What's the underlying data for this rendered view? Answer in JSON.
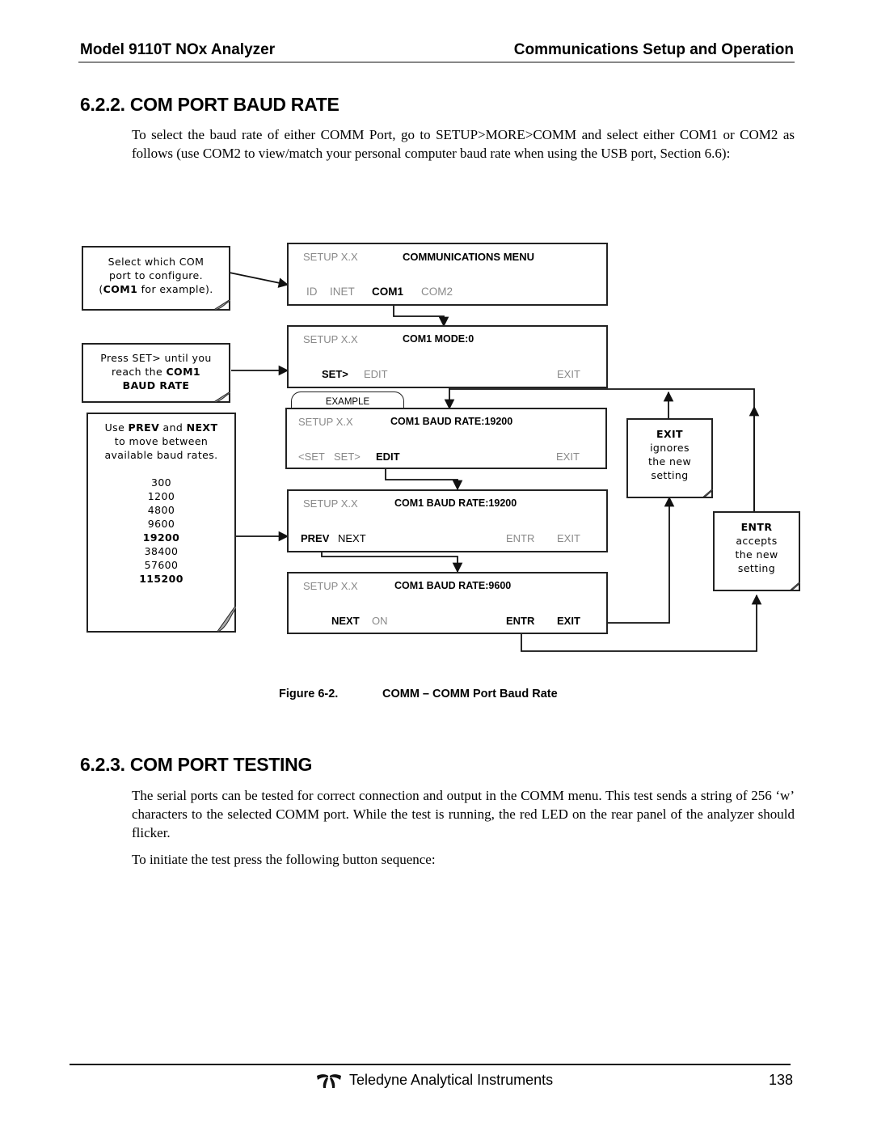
{
  "header": {
    "left": "Model 9110T NOx Analyzer",
    "right": "Communications Setup and Operation"
  },
  "section_baud": {
    "title": "6.2.2. COM PORT BAUD RATE",
    "paragraph": "To select the baud rate of either COMM Port, go to SETUP>MORE>COMM and select either COM1 or COM2 as follows (use COM2 to view/match your personal computer baud rate when using the USB port, Section 6.6):"
  },
  "figure": {
    "notes": {
      "select_com": {
        "line1": "Select which COM",
        "line2": "port to configure.",
        "line3_pre": "(",
        "line3_bold": "COM1",
        "line3_post": " for example)."
      },
      "press_set": {
        "line1": "Press SET> until you",
        "line2_pre": "reach the ",
        "line2_bold": "COM1",
        "line3_bold": "BAUD RATE"
      },
      "prev_next": {
        "pre": "Use ",
        "b1": "PREV",
        "mid": " and ",
        "b2": "NEXT",
        "line2": "to move between",
        "line3": "available baud rates."
      },
      "exit": {
        "title": "EXIT",
        "line1": "ignores",
        "line2": "the new",
        "line3": "setting"
      },
      "entr": {
        "title": "ENTR",
        "line1": "accepts",
        "line2": "the new",
        "line3": "setting"
      }
    },
    "baud_rates": [
      "300",
      "1200",
      "4800",
      "9600",
      "19200",
      "38400",
      "57600",
      "115200"
    ],
    "baud_rates_bold": [
      "19200",
      "115200"
    ],
    "example_label": "EXAMPLE",
    "screens": {
      "comm_menu": {
        "setup": "SETUP X.X",
        "title": "COMMUNICATIONS MENU",
        "btn_id": "ID",
        "btn_inet": "INET",
        "btn_com1": "COM1",
        "btn_com2": "COM2"
      },
      "com1_mode": {
        "setup": "SETUP X.X",
        "title": "COM1 MODE:0",
        "btn_set": "SET>",
        "btn_edit": "EDIT",
        "btn_exit": "EXIT"
      },
      "baud_view": {
        "setup": "SETUP X.X",
        "title": "COM1 BAUD RATE:19200",
        "btn_prevset": "<SET",
        "btn_set": "SET>",
        "btn_edit": "EDIT",
        "btn_exit": "EXIT"
      },
      "baud_edit": {
        "setup": "SETUP X.X",
        "title": "COM1 BAUD RATE:19200",
        "btn_prev": "PREV",
        "btn_next": "NEXT",
        "btn_entr": "ENTR",
        "btn_exit": "EXIT"
      },
      "baud_new": {
        "setup": "SETUP X.X",
        "title": "COM1 BAUD RATE:9600",
        "btn_next": "NEXT",
        "btn_on": "ON",
        "btn_entr": "ENTR",
        "btn_exit": "EXIT"
      }
    },
    "caption_label": "Figure 6-2.",
    "caption_title": "COMM – COMM Port Baud Rate"
  },
  "section_testing": {
    "title": "6.2.3. COM PORT TESTING",
    "paragraph1": "The serial ports can be tested for correct connection and output in the COMM menu.  This test sends a string of 256 ‘w’ characters to the selected COMM port.  While the test is running, the red LED on the rear panel of the analyzer should flicker.",
    "paragraph2": "To initiate the test press the following button sequence:"
  },
  "footer": {
    "logo_icon": "teledyne-logo-icon",
    "company": "Teledyne Analytical Instruments",
    "page_number": "138"
  }
}
